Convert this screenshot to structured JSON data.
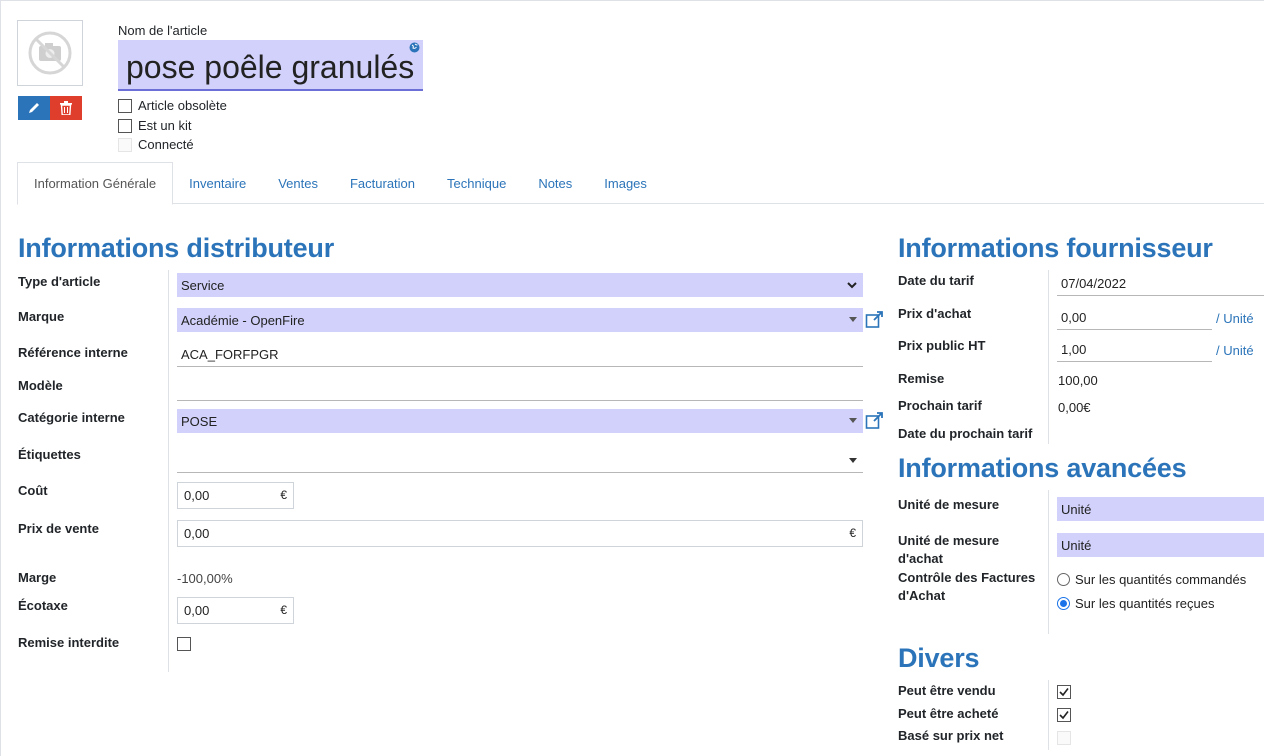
{
  "header": {
    "name_label": "Nom de l'article",
    "name_value": "pose poêle granulés",
    "checkboxes": [
      {
        "label": "Article obsolète",
        "checked": false,
        "disabled": false
      },
      {
        "label": "Est un kit",
        "checked": false,
        "disabled": false
      },
      {
        "label": "Connecté",
        "checked": false,
        "disabled": true
      }
    ],
    "icons": {
      "avatar": "camera-placeholder-icon",
      "edit": "pencil-icon",
      "delete": "trash-icon",
      "translate": "globe-icon"
    }
  },
  "tabs": [
    {
      "label": "Information Générale",
      "active": true
    },
    {
      "label": "Inventaire",
      "active": false
    },
    {
      "label": "Ventes",
      "active": false
    },
    {
      "label": "Facturation",
      "active": false
    },
    {
      "label": "Technique",
      "active": false
    },
    {
      "label": "Notes",
      "active": false
    },
    {
      "label": "Images",
      "active": false
    }
  ],
  "distributor": {
    "title": "Informations distributeur",
    "type_label": "Type d'article",
    "type_value": "Service",
    "brand_label": "Marque",
    "brand_value": "Académie - OpenFire",
    "ref_label": "Référence interne",
    "ref_value": "ACA_FORFPGR",
    "model_label": "Modèle",
    "model_value": "",
    "category_label": "Catégorie interne",
    "category_value": "POSE",
    "tags_label": "Étiquettes",
    "tags_value": "",
    "cost_label": "Coût",
    "cost_value": "0,00",
    "price_label": "Prix de vente",
    "price_value": "0,00",
    "margin_label": "Marge",
    "margin_value": "-100,00%",
    "ecotax_label": "Écotaxe",
    "ecotax_value": "0,00",
    "no_discount_label": "Remise interdite",
    "currency": "€"
  },
  "supplier": {
    "title": "Informations fournisseur",
    "tariff_date_label": "Date du tarif",
    "tariff_date_value": "07/04/2022",
    "purchase_label": "Prix d'achat",
    "purchase_value": "0,00",
    "public_label": "Prix public HT",
    "public_value": "1,00",
    "unit_sep": "/",
    "unit_link": "Unité",
    "discount_label": "Remise",
    "discount_value": "100,00",
    "next_tariff_label": "Prochain tarif",
    "next_tariff_value": "0,00€",
    "next_tariff_date_label": "Date du prochain tarif"
  },
  "advanced": {
    "title": "Informations avancées",
    "uom_label": "Unité de mesure",
    "uom_value": "Unité",
    "purchase_uom_label_1": "Unité de mesure",
    "purchase_uom_label_2": "d'achat",
    "purchase_uom_value": "Unité",
    "control_label_1": "Contrôle des Factures",
    "control_label_2": "d'Achat",
    "control_options": [
      {
        "label": "Sur les quantités commandés",
        "selected": false
      },
      {
        "label": "Sur les quantités reçues",
        "selected": true
      }
    ]
  },
  "misc": {
    "title": "Divers",
    "items": [
      {
        "label": "Peut être vendu",
        "checked": true,
        "disabled": false
      },
      {
        "label": "Peut être acheté",
        "checked": true,
        "disabled": false
      },
      {
        "label": "Basé sur prix net",
        "checked": false,
        "disabled": true
      }
    ]
  },
  "colors": {
    "accent": "#2b74b9",
    "field_highlight": "#d1d1fb",
    "delete": "#e03e2d"
  }
}
